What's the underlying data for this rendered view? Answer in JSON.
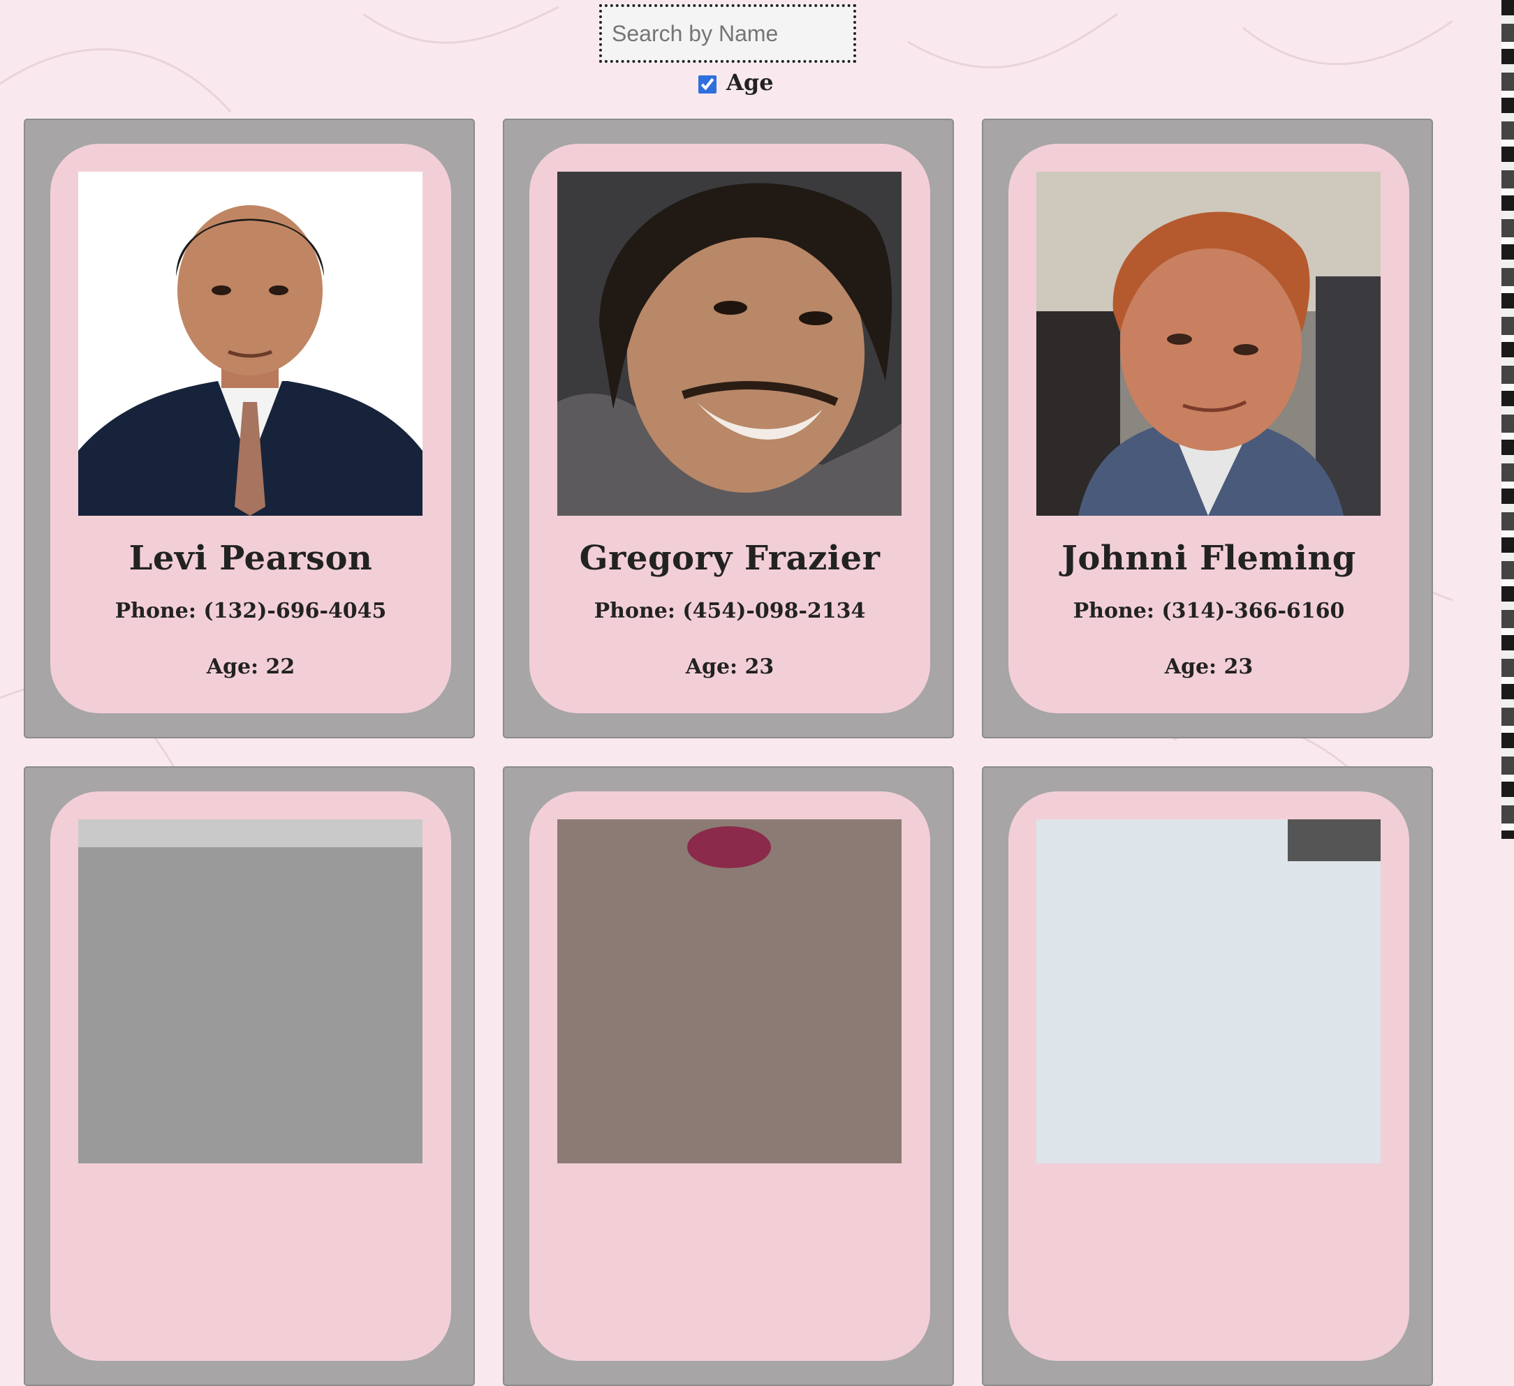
{
  "search": {
    "placeholder": "Search by Name",
    "value": ""
  },
  "filters": {
    "age_label": "Age",
    "age_checked": true
  },
  "people": [
    {
      "name": "Levi Pearson",
      "phone": "Phone: (132)-696-4045",
      "age": "Age: 22",
      "photo_icon": "portrait-photo"
    },
    {
      "name": "Gregory Frazier",
      "phone": "Phone: (454)-098-2134",
      "age": "Age: 23",
      "photo_icon": "portrait-photo"
    },
    {
      "name": "Johnni Fleming",
      "phone": "Phone: (314)-366-6160",
      "age": "Age: 23",
      "photo_icon": "portrait-photo"
    }
  ],
  "colors": {
    "page_background": "#f9e9ee",
    "card_outer": "#a7a5a6",
    "card_inner": "#f2cfd7",
    "checkbox_accent": "#2f6fdc"
  }
}
